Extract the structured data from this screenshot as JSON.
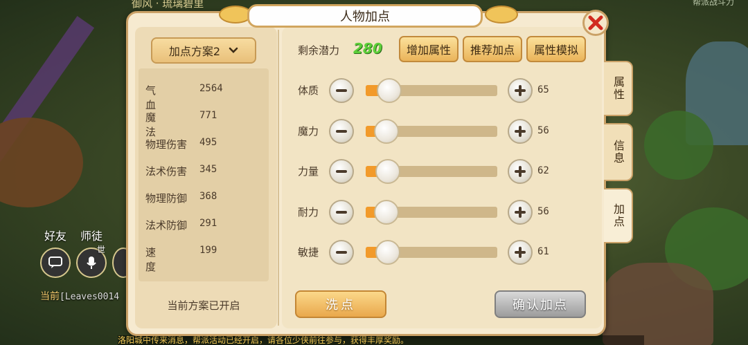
{
  "background": {
    "top_left_text": "御风 · 琉璃碧里",
    "top_right_text": "帮派战斗力",
    "hud": {
      "friends_label": "好友",
      "master_label": "师徒",
      "world_label": "世"
    },
    "chat": {
      "channel": "当前",
      "user": "[Leaves0014"
    },
    "ticker": "洛阳城中传来消息，帮派活动已经开启，请各位少侠前往参与，获得丰厚奖励。"
  },
  "panel": {
    "title": "人物加点",
    "close_icon": "close-x-icon",
    "plan_dropdown": {
      "label": "加点方案2",
      "icon": "chevron-down-icon"
    },
    "stats": [
      {
        "label": "气血",
        "value": "2564",
        "spaced": true
      },
      {
        "label": "魔法",
        "value": "771",
        "spaced": true
      },
      {
        "label": "物理伤害",
        "value": "495",
        "spaced": false
      },
      {
        "label": "法术伤害",
        "value": "345",
        "spaced": false
      },
      {
        "label": "物理防御",
        "value": "368",
        "spaced": false
      },
      {
        "label": "法术防御",
        "value": "291",
        "spaced": false
      },
      {
        "label": "速度",
        "value": "199",
        "spaced": true
      }
    ],
    "plan_status": "当前方案已开启",
    "potential": {
      "label": "剩余潜力",
      "value": "280"
    },
    "buttons": {
      "add_attr": "增加属性",
      "recommend": "推荐加点",
      "simulate": "属性模拟",
      "wash": "洗点",
      "confirm": "确认加点"
    },
    "attributes": [
      {
        "label": "体质",
        "value": "65",
        "fill": 0.18
      },
      {
        "label": "魔力",
        "value": "56",
        "fill": 0.16
      },
      {
        "label": "力量",
        "value": "62",
        "fill": 0.17
      },
      {
        "label": "耐力",
        "value": "56",
        "fill": 0.16
      },
      {
        "label": "敏捷",
        "value": "61",
        "fill": 0.17
      }
    ],
    "side_tabs": [
      {
        "label": "属性",
        "active": false
      },
      {
        "label": "信息",
        "active": false
      },
      {
        "label": "加点",
        "active": true
      }
    ]
  }
}
